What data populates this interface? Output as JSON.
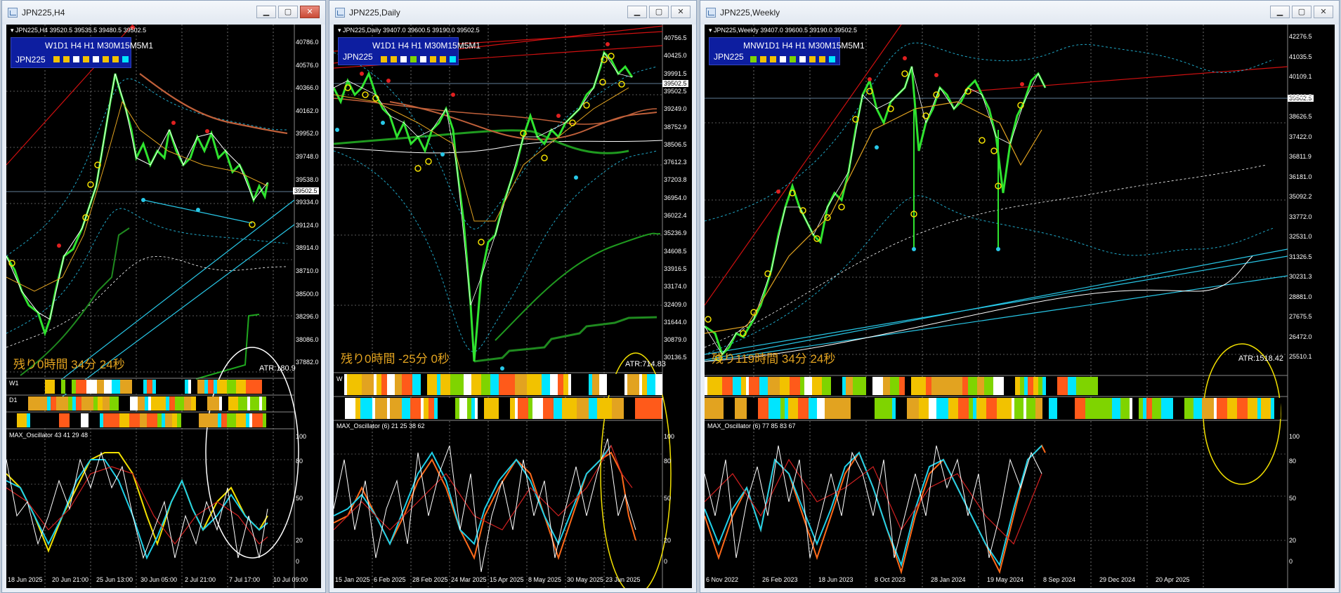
{
  "windows": [
    {
      "id": "h4",
      "title": "JPN225,H4",
      "symbol_line": "JPN225,H4  39520.5 39535.5 39480.5 39502.5",
      "tf_labels": "W1D1 H4 H1 M30M15M5M1",
      "tf_name": "JPN225",
      "tf_colors": [
        "#f2c200",
        "#f2c200",
        "#ffffff",
        "#f2c200",
        "#ffffff",
        "#f2c200",
        "#f2c200",
        "#00e5ff"
      ],
      "remaining": "残り0時間 34分 24秒",
      "atr": "ATR:180.9",
      "osc_label": "MAX_Oscillator 43 41 29 48",
      "row_labels": [
        "W1",
        "D1"
      ],
      "price_tag": "39502.5",
      "y_ticks": [
        "40786.0",
        "40576.0",
        "40366.0",
        "40162.0",
        "39952.0",
        "39748.0",
        "39538.0",
        "39334.0",
        "39124.0",
        "38914.0",
        "38710.0",
        "38500.0",
        "38296.0",
        "38086.0",
        "37882.0"
      ],
      "osc_ticks": [
        "100",
        "80",
        "50",
        "20",
        "0"
      ],
      "x_ticks": [
        "18 Jun 2025",
        "20 Jun 21:00",
        "25 Jun 13:00",
        "30 Jun 05:00",
        "2 Jul 21:00",
        "7 Jul 17:00",
        "10 Jul 09:00"
      ]
    },
    {
      "id": "daily",
      "title": "JPN225,Daily",
      "symbol_line": "JPN225,Daily  39407.0 39600.5 39190.0 39502.5",
      "tf_labels": "W1D1 H4 H1 M30M15M5M1",
      "tf_name": "JPN225",
      "tf_colors": [
        "#f2c200",
        "#f2c200",
        "#ffffff",
        "#7fd400",
        "#ffffff",
        "#f2c200",
        "#f2c200",
        "#00e5ff"
      ],
      "remaining": "残り0時間 -25分 0秒",
      "atr": "ATR:714.83",
      "osc_label": "MAX_Oscillator (6) 21 25 38 62",
      "row_labels": [
        "W",
        ""
      ],
      "price_tag": "39502.5",
      "y_ticks": [
        "40756.5",
        "40425.0",
        "39991.5",
        "39502.5",
        "39249.0",
        "38752.9",
        "38506.5",
        "37612.3",
        "37203.8",
        "36954.0",
        "36022.4",
        "35236.9",
        "34608.5",
        "33916.5",
        "33174.0",
        "32409.0",
        "31644.0",
        "30879.0",
        "30136.5"
      ],
      "osc_ticks": [
        "100",
        "80",
        "50",
        "20",
        "0"
      ],
      "x_ticks": [
        "15 Jan 2025",
        "6 Feb 2025",
        "28 Feb 2025",
        "24 Mar 2025",
        "15 Apr 2025",
        "8 May 2025",
        "30 May 2025",
        "23 Jun 2025"
      ]
    },
    {
      "id": "weekly",
      "title": "JPN225,Weekly",
      "symbol_line": "JPN225,Weekly  39407.0 39600.5 39190.0 39502.5",
      "tf_labels": "MNW1D1 H4 H1 M30M15M5M1",
      "tf_name": "JPN225",
      "tf_colors": [
        "#7fd400",
        "#f2c200",
        "#f2c200",
        "#ffffff",
        "#7fd400",
        "#ffffff",
        "#f2c200",
        "#f2c200",
        "#00e5ff"
      ],
      "remaining": "残り119時間 34分 24秒",
      "atr": "ATR:1518.42",
      "osc_label": "MAX_Oscillator (6) 77 85 83 67",
      "row_labels": [
        "",
        ""
      ],
      "price_tag": "39502.5",
      "y_ticks": [
        "42276.5",
        "41035.5",
        "40109.1",
        "39502.5",
        "38626.5",
        "37422.0",
        "36811.9",
        "36181.0",
        "35092.2",
        "33772.0",
        "32531.0",
        "31326.5",
        "30231.3",
        "28881.0",
        "27675.5",
        "26472.0",
        "25510.1"
      ],
      "osc_ticks": [
        "100",
        "80",
        "50",
        "20",
        "0"
      ],
      "x_ticks": [
        "6 Nov 2022",
        "26 Feb 2023",
        "18 Jun 2023",
        "8 Oct 2023",
        "28 Jan 2024",
        "19 May 2024",
        "8 Sep 2024",
        "29 Dec 2024",
        "20 Apr 2025"
      ]
    }
  ]
}
